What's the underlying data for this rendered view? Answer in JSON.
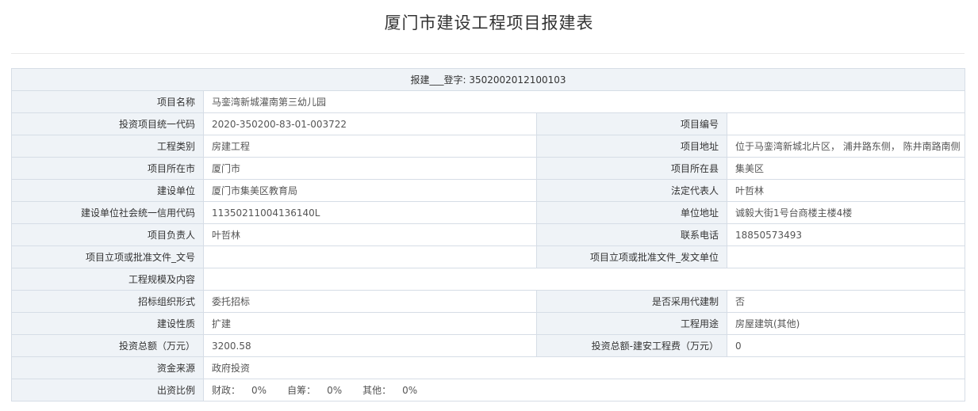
{
  "page": {
    "title": "厦门市建设工程项目报建表"
  },
  "header_row": {
    "text": "报建___登字: 3502002012100103"
  },
  "rows": {
    "project_name": {
      "label": "项目名称",
      "value": "马銮湾新城灌南第三幼儿园"
    },
    "invest_code": {
      "label": "投资项目统一代码",
      "value": "2020-350200-83-01-003722"
    },
    "project_no": {
      "label": "项目编号",
      "value": ""
    },
    "eng_category": {
      "label": "工程类别",
      "value": "房建工程"
    },
    "project_address": {
      "label": "项目地址",
      "value": "位于马銮湾新城北片区， 浦井路东侧， 陈井南路南侧"
    },
    "city": {
      "label": "项目所在市",
      "value": "厦门市"
    },
    "county": {
      "label": "项目所在县",
      "value": "集美区"
    },
    "builder": {
      "label": "建设单位",
      "value": "厦门市集美区教育局"
    },
    "legal_rep": {
      "label": "法定代表人",
      "value": "叶哲林"
    },
    "credit_code": {
      "label": "建设单位社会统一信用代码",
      "value": "11350211004136140L"
    },
    "unit_address": {
      "label": "单位地址",
      "value": "诚毅大街1号台商楼主楼4楼"
    },
    "leader": {
      "label": "项目负责人",
      "value": "叶哲林"
    },
    "phone": {
      "label": "联系电话",
      "value": "18850573493"
    },
    "approval_doc_no": {
      "label": "项目立项或批准文件_文号",
      "value": ""
    },
    "approval_doc_unit": {
      "label": "项目立项或批准文件_发文单位",
      "value": ""
    },
    "scale": {
      "label": "工程规模及内容",
      "value": ""
    },
    "bidding": {
      "label": "招标组织形式",
      "value": "委托招标"
    },
    "agent_system": {
      "label": "是否采用代建制",
      "value": "否"
    },
    "nature": {
      "label": "建设性质",
      "value": "扩建"
    },
    "usage": {
      "label": "工程用途",
      "value": "房屋建筑(其他)"
    },
    "invest_total": {
      "label": "投资总额（万元）",
      "value": "3200.58"
    },
    "invest_install": {
      "label": "投资总额-建安工程费（万元）",
      "value": "0"
    },
    "fund_source": {
      "label": "资金来源",
      "value": "政府投资"
    },
    "ratio": {
      "label": "出资比例",
      "finance_label": "财政：",
      "finance_value": "0%",
      "self_label": "自筹：",
      "self_value": "0%",
      "other_label": "其他：",
      "other_value": "0%"
    }
  }
}
